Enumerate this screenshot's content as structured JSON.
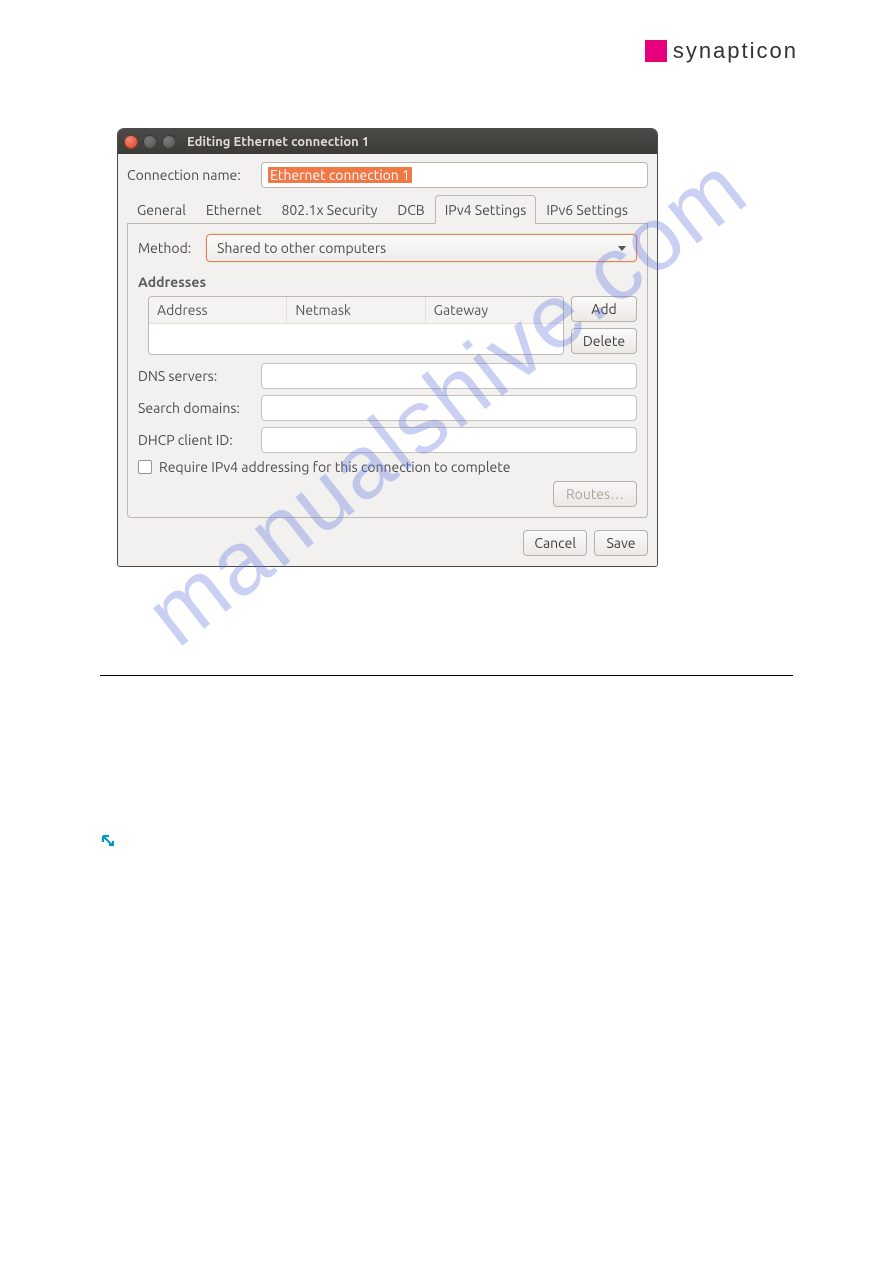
{
  "brand": {
    "name": "synapticon"
  },
  "dialog": {
    "title": "Editing Ethernet connection 1",
    "connection_name_label": "Connection name:",
    "connection_name_value": "Ethernet connection 1",
    "tabs": {
      "general": "General",
      "ethernet": "Ethernet",
      "security": "802.1x Security",
      "dcb": "DCB",
      "ipv4": "IPv4 Settings",
      "ipv6": "IPv6 Settings"
    },
    "ipv4": {
      "method_label": "Method:",
      "method_value": "Shared to other computers",
      "addresses_title": "Addresses",
      "columns": {
        "address": "Address",
        "netmask": "Netmask",
        "gateway": "Gateway"
      },
      "add_btn": "Add",
      "delete_btn": "Delete",
      "dns_label": "DNS servers:",
      "search_label": "Search domains:",
      "dhcp_label": "DHCP client ID:",
      "require_label": "Require IPv4 addressing for this connection to complete",
      "routes_btn": "Routes…"
    },
    "cancel": "Cancel",
    "save": "Save"
  },
  "watermark": "manualshive.com"
}
